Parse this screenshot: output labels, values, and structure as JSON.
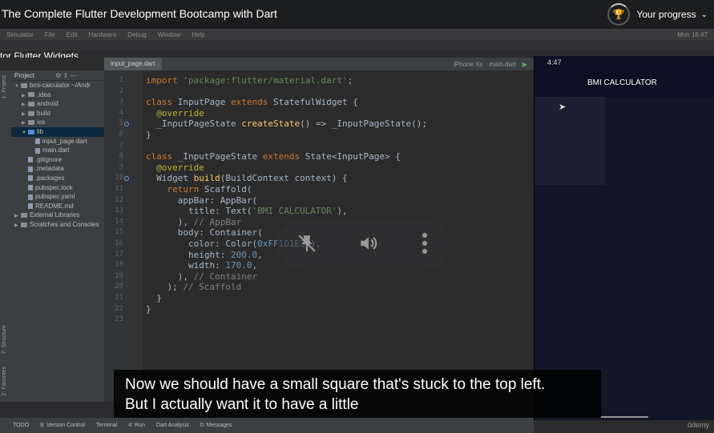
{
  "header": {
    "course_title": "The Complete Flutter Development Bootcamp with Dart",
    "progress_icon": "trophy-icon",
    "progress_label": "Your progress"
  },
  "video": {
    "section_label": "tor Flutter Widgets",
    "macbar": {
      "items": [
        "Simulator",
        "File",
        "Edit",
        "Hardware",
        "Debug",
        "Window",
        "Help"
      ],
      "right": "Mon 16:47"
    },
    "ide": {
      "active_tab": "input_page.dart",
      "run_config": [
        "iPhone Xs",
        "main.dart"
      ],
      "project_header": "Project",
      "tree": [
        {
          "label": "bmi-calculator ~/Andr",
          "type": "folder",
          "indent": 0,
          "expanded": true
        },
        {
          "label": ".idea",
          "type": "folder",
          "indent": 1
        },
        {
          "label": "android",
          "type": "folder",
          "indent": 1
        },
        {
          "label": "build",
          "type": "folder",
          "indent": 1
        },
        {
          "label": "ios",
          "type": "folder",
          "indent": 1
        },
        {
          "label": "lib",
          "type": "folder-blue",
          "indent": 1,
          "expanded": true,
          "selected": true
        },
        {
          "label": "input_page.dart",
          "type": "file",
          "indent": 2
        },
        {
          "label": "main.dart",
          "type": "file",
          "indent": 2
        },
        {
          "label": ".gitignore",
          "type": "file",
          "indent": 1
        },
        {
          "label": ".metadata",
          "type": "file",
          "indent": 1
        },
        {
          "label": ".packages",
          "type": "file",
          "indent": 1
        },
        {
          "label": "pubspec.lock",
          "type": "file",
          "indent": 1
        },
        {
          "label": "pubspec.yaml",
          "type": "file",
          "indent": 1
        },
        {
          "label": "README.md",
          "type": "file",
          "indent": 1
        },
        {
          "label": "External Libraries",
          "type": "folder",
          "indent": 0
        },
        {
          "label": "Scratches and Consoles",
          "type": "folder",
          "indent": 0
        }
      ],
      "code": [
        "import 'package:flutter/material.dart';",
        "",
        "class InputPage extends StatefulWidget {",
        "  @override",
        "  _InputPageState createState() => _InputPageState();",
        "}",
        "",
        "class _InputPageState extends State<InputPage> {",
        "  @override",
        "  Widget build(BuildContext context) {",
        "    return Scaffold(",
        "      appBar: AppBar(",
        "        title: Text('BMI CALCULATOR'),",
        "      ), // AppBar",
        "      body: Container(",
        "        color: Color(0xFF1D1E33),",
        "        height: 200.0,",
        "        width: 170.0,",
        "      ), // Container",
        "    ); // Scaffold",
        "  }",
        "}",
        ""
      ],
      "bottom_tabs": [
        "TODO",
        "9: Version Control",
        "Terminal",
        "4: Run",
        "Dart Analysis",
        "0: Messages"
      ],
      "side_tabs": [
        "1: Project",
        "7: Structure",
        "2: Favorites"
      ]
    },
    "phone": {
      "time": "4:47",
      "app_title": "BMI CALCULATOR"
    },
    "controls": {
      "icons": [
        "pin-off-icon",
        "volume-icon",
        "more-icon"
      ]
    },
    "caption": {
      "lines": [
        "Now we should have a small square that's stuck to the top left.",
        "But I actually want it to have a little"
      ]
    },
    "watermark": "ûdemy"
  }
}
